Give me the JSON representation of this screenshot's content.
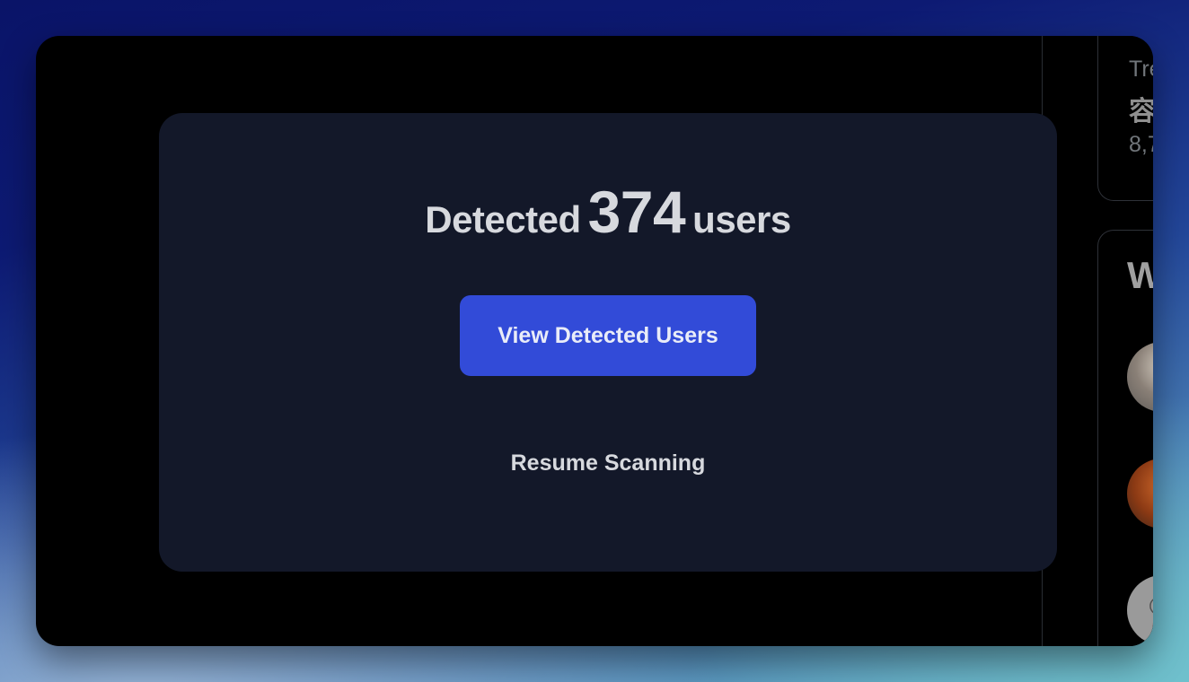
{
  "sidebar": {
    "trend": {
      "label": "Tre",
      "name": "容",
      "count": "8,7"
    },
    "who_to_follow": {
      "title": "W"
    }
  },
  "modal": {
    "headline_prefix": "Detected",
    "headline_count": "374",
    "headline_suffix": "users",
    "primary_button_label": "View Detected Users",
    "secondary_button_label": "Resume Scanning"
  },
  "colors": {
    "modal_background": "#131829",
    "primary_button": "#324bd8",
    "window_background": "#000000"
  },
  "icons": {
    "avatar_3_glyph": "person-icon"
  }
}
